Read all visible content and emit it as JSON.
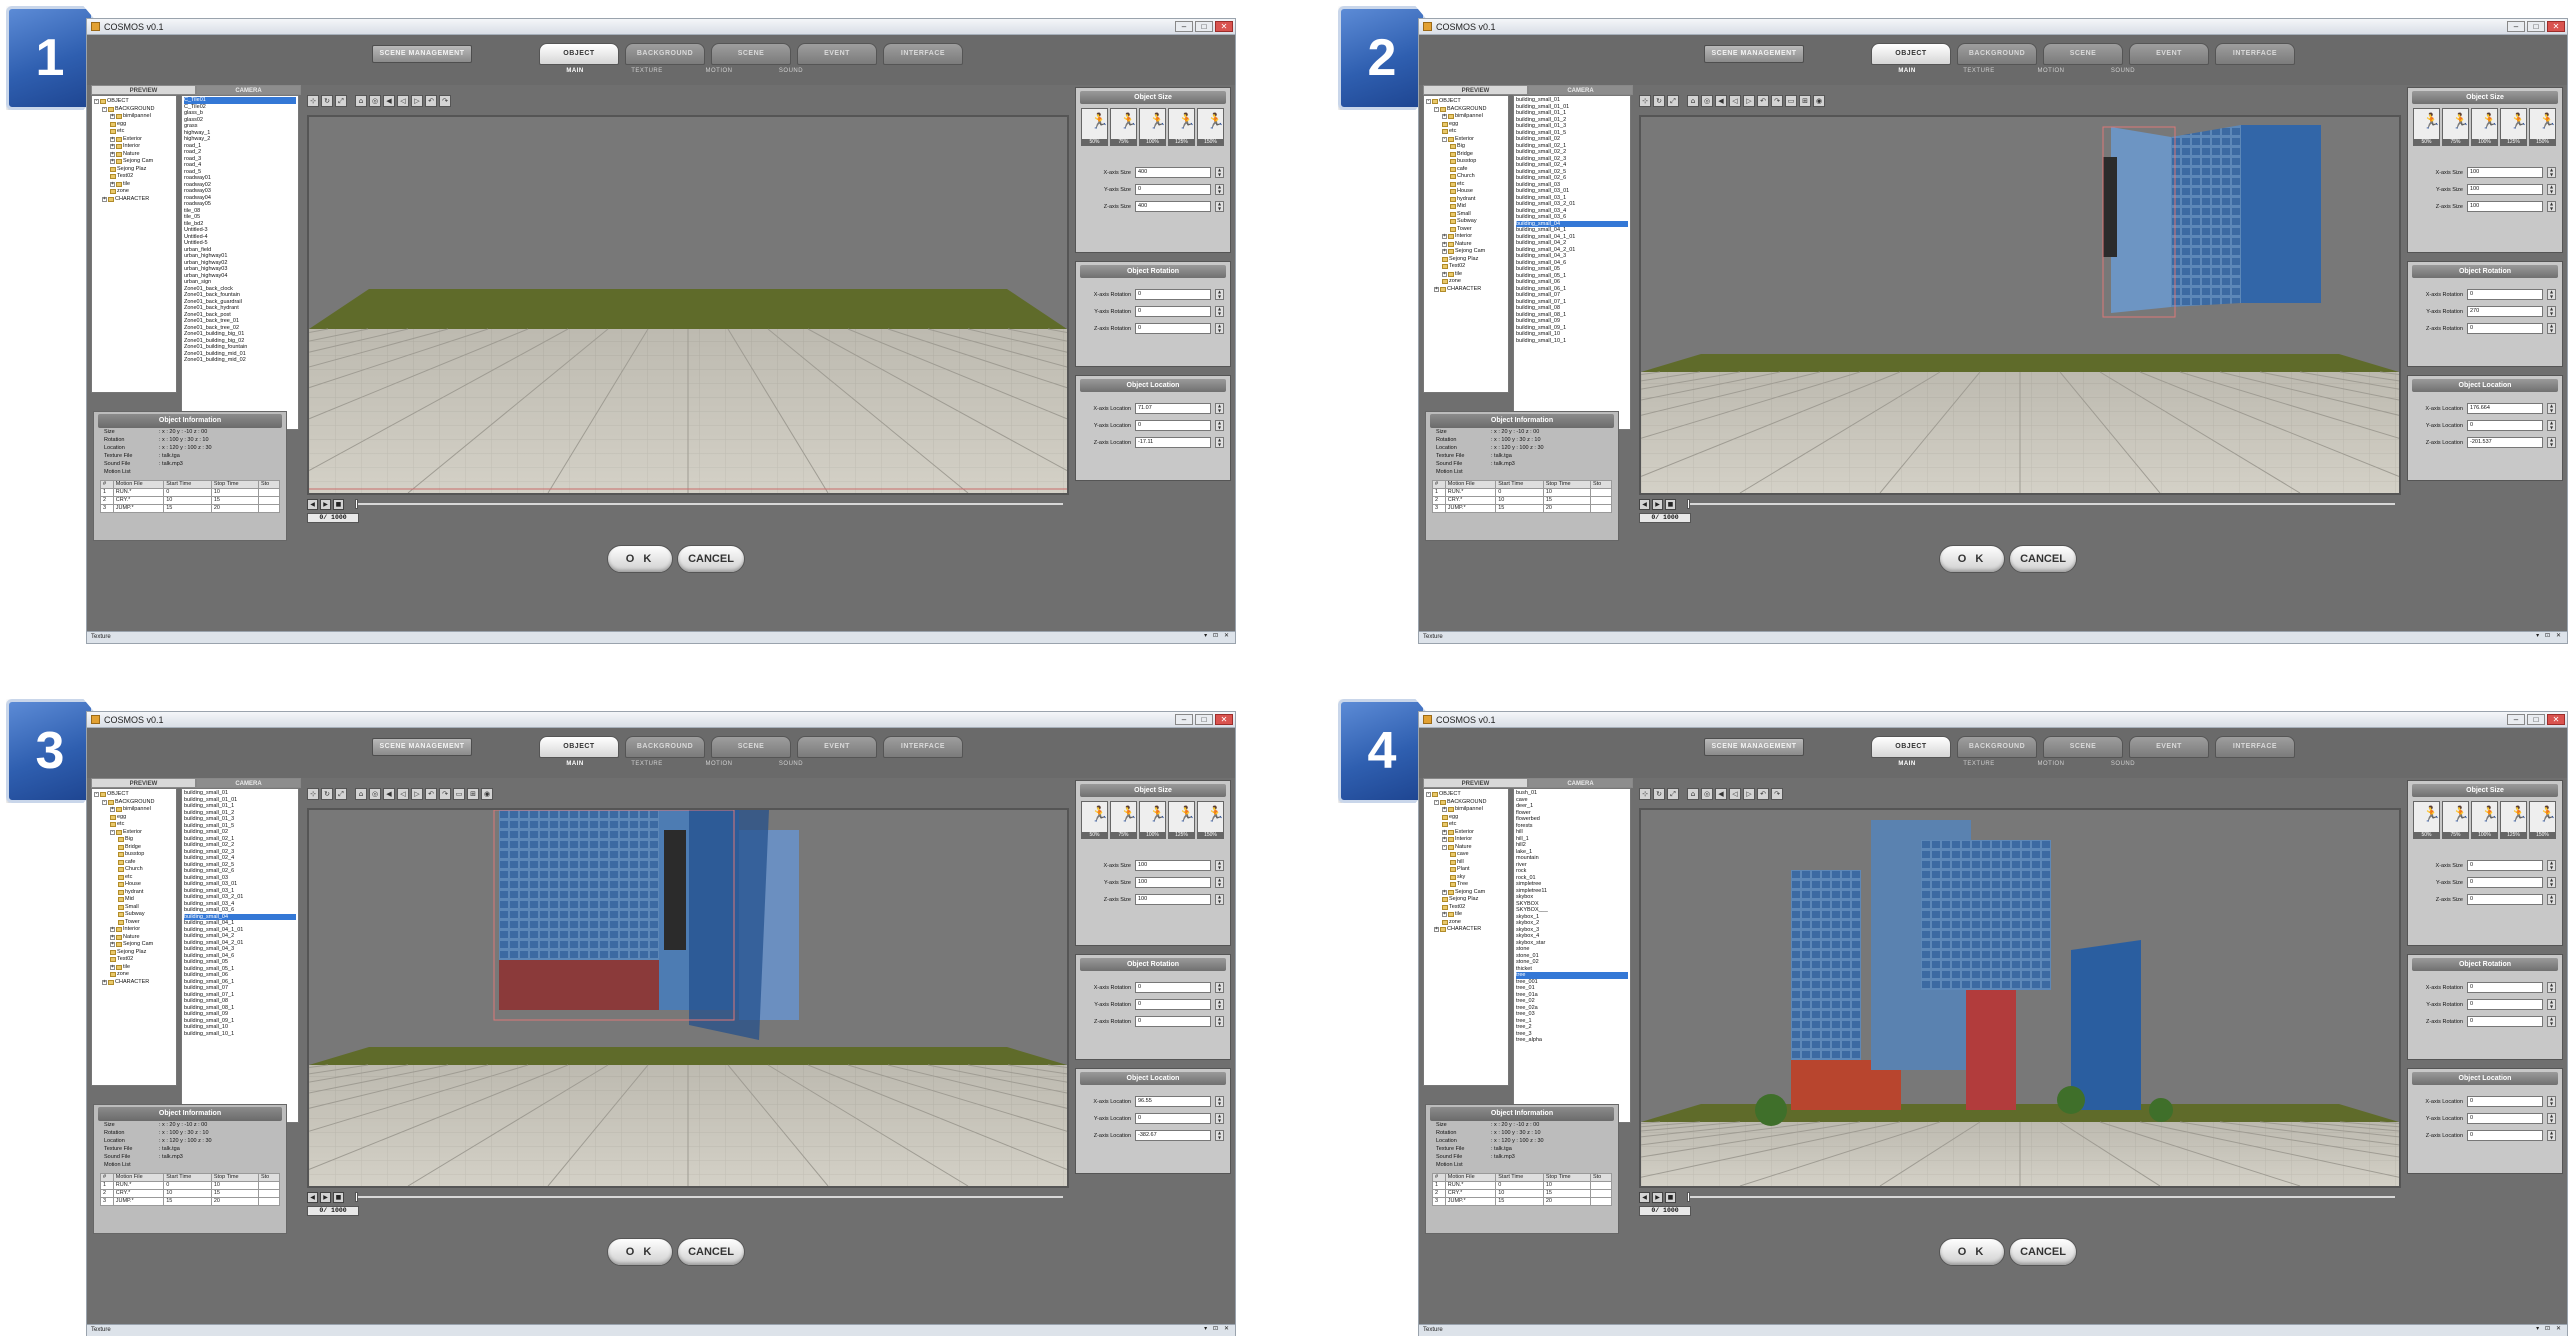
{
  "window": {
    "app_title": "COSMOS v0.1",
    "status_text": "Texture"
  },
  "toolbar_top": {
    "scene_management": "SCENE MANAGEMENT",
    "tabs": [
      "OBJECT",
      "BACKGROUND",
      "SCENE",
      "EVENT",
      "INTERFACE"
    ],
    "subtabs": [
      "MAIN",
      "TEXTURE",
      "MOTION",
      "SOUND"
    ]
  },
  "left_tabs": {
    "preview": "PREVIEW",
    "camera": "CAMERA"
  },
  "object_information": {
    "header": "Object Information",
    "rows": [
      {
        "k": "Size",
        "v": ":   x : 20   y : -10   z : 00"
      },
      {
        "k": "Rotation",
        "v": ":   x : 100   y : 30   z : 10"
      },
      {
        "k": "Location",
        "v": ":   x : 120   y : 100   z : 30"
      },
      {
        "k": "Texture File",
        "v": ":   talk.tga"
      },
      {
        "k": "Sound File",
        "v": ":   talk.mp3"
      },
      {
        "k": "Motion List",
        "v": ""
      }
    ],
    "motion_headers": [
      "#",
      "Motion File",
      "Start Time",
      "Stop Time",
      "Sto"
    ],
    "motion_rows": [
      [
        "1",
        "RUN.*",
        "0",
        "10",
        ""
      ],
      [
        "2",
        "CRY.*",
        "10",
        "15",
        ""
      ],
      [
        "3",
        "JUMP.*",
        "15",
        "20",
        ""
      ]
    ]
  },
  "right_panel": {
    "size_header": "Object Size",
    "size_buttons": [
      "50%",
      "75%",
      "100%",
      "125%",
      "150%"
    ],
    "size_labels": [
      "X-axis Size",
      "Y-axis Size",
      "Z-axis Size"
    ],
    "rotation_header": "Object Rotation",
    "rotation_labels": [
      "X-axis Rotation",
      "Y-axis Rotation",
      "Z-axis Rotation"
    ],
    "location_header": "Object Location",
    "location_labels": [
      "X-axis Location",
      "Y-axis Location",
      "Z-axis Location"
    ]
  },
  "buttons": {
    "ok": "O K",
    "cancel": "CANCEL"
  },
  "timeline": {
    "counter": "0/ 1000"
  },
  "panels": [
    {
      "number": "1",
      "tree": [
        {
          "label": "OBJECT",
          "depth": 0,
          "exp": "-"
        },
        {
          "label": "BACKGROUND",
          "depth": 1,
          "exp": "-"
        },
        {
          "label": "bimilpannel",
          "depth": 2,
          "exp": "+"
        },
        {
          "label": "egg",
          "depth": 2,
          "exp": ""
        },
        {
          "label": "etc",
          "depth": 2,
          "exp": ""
        },
        {
          "label": "Exterior",
          "depth": 2,
          "exp": "+"
        },
        {
          "label": "Interior",
          "depth": 2,
          "exp": "+"
        },
        {
          "label": "Nature",
          "depth": 2,
          "exp": "+"
        },
        {
          "label": "Sejong Cam",
          "depth": 2,
          "exp": "+"
        },
        {
          "label": "Sejong Plaz",
          "depth": 2,
          "exp": ""
        },
        {
          "label": "Test02",
          "depth": 2,
          "exp": ""
        },
        {
          "label": "tile",
          "depth": 2,
          "exp": "+"
        },
        {
          "label": "zone",
          "depth": 2,
          "exp": ""
        },
        {
          "label": "CHARACTER",
          "depth": 1,
          "exp": "+"
        }
      ],
      "list": [
        "C_Tile01",
        "C_Tile02",
        "glass_b",
        "glass02",
        "grass",
        "highway_1",
        "highway_2",
        "road_1",
        "road_2",
        "road_3",
        "road_4",
        "road_5",
        "roadway01",
        "roadway02",
        "roadway03",
        "roadway04",
        "roadway05",
        "tile_08",
        "tile_05",
        "tile_bd2",
        "Untitled-3",
        "Untitled-4",
        "Untitled-5",
        "urban_field",
        "urban_highway01",
        "urban_highway02",
        "urban_highway03",
        "urban_highway04",
        "urban_sign",
        "Zone01_back_clock",
        "Zone01_back_fountain",
        "Zone01_back_guardrail",
        "Zone01_back_hydrant",
        "Zone01_back_post",
        "Zone01_back_tree_01",
        "Zone01_back_tree_02",
        "Zone01_building_big_01",
        "Zone01_building_big_02",
        "Zone01_building_fountain",
        "Zone01_building_mid_01",
        "Zone01_building_mid_02"
      ],
      "selected": 0,
      "size": [
        "400",
        "0",
        "400"
      ],
      "rotation": [
        "0",
        "0",
        "0"
      ],
      "location": [
        "71.07",
        "0",
        "-17.11"
      ],
      "scene": "floor"
    },
    {
      "number": "2",
      "tree": [
        {
          "label": "OBJECT",
          "depth": 0,
          "exp": "-"
        },
        {
          "label": "BACKGROUND",
          "depth": 1,
          "exp": "-"
        },
        {
          "label": "bimilpannel",
          "depth": 2,
          "exp": "+"
        },
        {
          "label": "egg",
          "depth": 2,
          "exp": ""
        },
        {
          "label": "etc",
          "depth": 2,
          "exp": ""
        },
        {
          "label": "Exterior",
          "depth": 2,
          "exp": "-"
        },
        {
          "label": "Big",
          "depth": 3,
          "exp": ""
        },
        {
          "label": "Bridge",
          "depth": 3,
          "exp": ""
        },
        {
          "label": "busstop",
          "depth": 3,
          "exp": ""
        },
        {
          "label": "cafe",
          "depth": 3,
          "exp": ""
        },
        {
          "label": "Church",
          "depth": 3,
          "exp": ""
        },
        {
          "label": "etc",
          "depth": 3,
          "exp": ""
        },
        {
          "label": "House",
          "depth": 3,
          "exp": ""
        },
        {
          "label": "hydrant",
          "depth": 3,
          "exp": ""
        },
        {
          "label": "Mid",
          "depth": 3,
          "exp": ""
        },
        {
          "label": "Small",
          "depth": 3,
          "exp": ""
        },
        {
          "label": "Subway",
          "depth": 3,
          "exp": ""
        },
        {
          "label": "Tower",
          "depth": 3,
          "exp": ""
        },
        {
          "label": "Interior",
          "depth": 2,
          "exp": "+"
        },
        {
          "label": "Nature",
          "depth": 2,
          "exp": "+"
        },
        {
          "label": "Sejong Cam",
          "depth": 2,
          "exp": "+"
        },
        {
          "label": "Sejong Plaz",
          "depth": 2,
          "exp": ""
        },
        {
          "label": "Test02",
          "depth": 2,
          "exp": ""
        },
        {
          "label": "tile",
          "depth": 2,
          "exp": "+"
        },
        {
          "label": "zone",
          "depth": 2,
          "exp": ""
        },
        {
          "label": "CHARACTER",
          "depth": 1,
          "exp": "+"
        }
      ],
      "list": [
        "building_small_01",
        "building_small_01_01",
        "building_small_01_1",
        "building_small_01_2",
        "building_small_01_3",
        "building_small_01_5",
        "building_small_02",
        "building_small_02_1",
        "building_small_02_2",
        "building_small_02_3",
        "building_small_02_4",
        "building_small_02_5",
        "building_small_02_6",
        "building_small_03",
        "building_small_03_01",
        "building_small_03_1",
        "building_small_03_2_01",
        "building_small_03_4",
        "building_small_03_6",
        "building_small_04",
        "building_small_04_1",
        "building_small_04_1_01",
        "building_small_04_2",
        "building_small_04_2_01",
        "building_small_04_3",
        "building_small_04_6",
        "building_small_05",
        "building_small_05_1",
        "building_small_06",
        "building_small_06_1",
        "building_small_07",
        "building_small_07_1",
        "building_small_08",
        "building_small_08_1",
        "building_small_09",
        "building_small_09_1",
        "building_small_10",
        "building_small_10_1"
      ],
      "selected": 19,
      "size": [
        "100",
        "100",
        "100"
      ],
      "rotation": [
        "0",
        "270",
        "0"
      ],
      "location": [
        "176.664",
        "0",
        "-201.537"
      ],
      "scene": "building"
    },
    {
      "number": "3",
      "tree": [
        {
          "label": "OBJECT",
          "depth": 0,
          "exp": "-"
        },
        {
          "label": "BACKGROUND",
          "depth": 1,
          "exp": "-"
        },
        {
          "label": "bimilpannel",
          "depth": 2,
          "exp": "+"
        },
        {
          "label": "egg",
          "depth": 2,
          "exp": ""
        },
        {
          "label": "etc",
          "depth": 2,
          "exp": ""
        },
        {
          "label": "Exterior",
          "depth": 2,
          "exp": "-"
        },
        {
          "label": "Big",
          "depth": 3,
          "exp": ""
        },
        {
          "label": "Bridge",
          "depth": 3,
          "exp": ""
        },
        {
          "label": "busstop",
          "depth": 3,
          "exp": ""
        },
        {
          "label": "cafe",
          "depth": 3,
          "exp": ""
        },
        {
          "label": "Church",
          "depth": 3,
          "exp": ""
        },
        {
          "label": "etc",
          "depth": 3,
          "exp": ""
        },
        {
          "label": "House",
          "depth": 3,
          "exp": ""
        },
        {
          "label": "hydrant",
          "depth": 3,
          "exp": ""
        },
        {
          "label": "Mid",
          "depth": 3,
          "exp": ""
        },
        {
          "label": "Small",
          "depth": 3,
          "exp": ""
        },
        {
          "label": "Subway",
          "depth": 3,
          "exp": ""
        },
        {
          "label": "Tower",
          "depth": 3,
          "exp": ""
        },
        {
          "label": "Interior",
          "depth": 2,
          "exp": "+"
        },
        {
          "label": "Nature",
          "depth": 2,
          "exp": "+"
        },
        {
          "label": "Sejong Cam",
          "depth": 2,
          "exp": "+"
        },
        {
          "label": "Sejong Plaz",
          "depth": 2,
          "exp": ""
        },
        {
          "label": "Test02",
          "depth": 2,
          "exp": ""
        },
        {
          "label": "tile",
          "depth": 2,
          "exp": "+"
        },
        {
          "label": "zone",
          "depth": 2,
          "exp": ""
        },
        {
          "label": "CHARACTER",
          "depth": 1,
          "exp": "+"
        }
      ],
      "list": [
        "building_small_01",
        "building_small_01_01",
        "building_small_01_1",
        "building_small_01_2",
        "building_small_01_3",
        "building_small_01_5",
        "building_small_02",
        "building_small_02_1",
        "building_small_02_2",
        "building_small_02_3",
        "building_small_02_4",
        "building_small_02_5",
        "building_small_02_6",
        "building_small_03",
        "building_small_03_01",
        "building_small_03_1",
        "building_small_03_2_01",
        "building_small_03_4",
        "building_small_03_6",
        "building_small_04",
        "building_small_04_1",
        "building_small_04_1_01",
        "building_small_04_2",
        "building_small_04_2_01",
        "building_small_04_3",
        "building_small_04_6",
        "building_small_05",
        "building_small_05_1",
        "building_small_06",
        "building_small_06_1",
        "building_small_07",
        "building_small_07_1",
        "building_small_08",
        "building_small_08_1",
        "building_small_09",
        "building_small_09_1",
        "building_small_10",
        "building_small_10_1"
      ],
      "selected": 19,
      "size": [
        "100",
        "100",
        "100"
      ],
      "rotation": [
        "0",
        "0",
        "0"
      ],
      "location": [
        "96.55",
        "0",
        "-382.67"
      ],
      "scene": "buildings"
    },
    {
      "number": "4",
      "tree": [
        {
          "label": "OBJECT",
          "depth": 0,
          "exp": "-"
        },
        {
          "label": "BACKGROUND",
          "depth": 1,
          "exp": "-"
        },
        {
          "label": "bimilpannel",
          "depth": 2,
          "exp": "+"
        },
        {
          "label": "egg",
          "depth": 2,
          "exp": ""
        },
        {
          "label": "etc",
          "depth": 2,
          "exp": ""
        },
        {
          "label": "Exterior",
          "depth": 2,
          "exp": "+"
        },
        {
          "label": "Interior",
          "depth": 2,
          "exp": "+"
        },
        {
          "label": "Nature",
          "depth": 2,
          "exp": "-"
        },
        {
          "label": "cave",
          "depth": 3,
          "exp": ""
        },
        {
          "label": "hill",
          "depth": 3,
          "exp": ""
        },
        {
          "label": "Plant",
          "depth": 3,
          "exp": ""
        },
        {
          "label": "sky",
          "depth": 3,
          "exp": ""
        },
        {
          "label": "Tree",
          "depth": 3,
          "exp": ""
        },
        {
          "label": "Sejong Cam",
          "depth": 2,
          "exp": "+"
        },
        {
          "label": "Sejong Plaz",
          "depth": 2,
          "exp": ""
        },
        {
          "label": "Test02",
          "depth": 2,
          "exp": ""
        },
        {
          "label": "tile",
          "depth": 2,
          "exp": "+"
        },
        {
          "label": "zone",
          "depth": 2,
          "exp": ""
        },
        {
          "label": "CHARACTER",
          "depth": 1,
          "exp": "+"
        }
      ],
      "list": [
        "bush_01",
        "cave",
        "deer_1",
        "flower",
        "flowerbed",
        "forests",
        "hill",
        "hill_1",
        "hill2",
        "lake_1",
        "mountain",
        "river",
        "rock",
        "rock_01",
        "simpletree",
        "simpletree11",
        "skybox",
        "SKYBOX",
        "SKYBOX___",
        "skybox_1",
        "skybox_2",
        "skybox_3",
        "skybox_4",
        "skybox_star",
        "stone",
        "stone_01",
        "stone_02",
        "thicket",
        "tree",
        "tree_001",
        "tree_01",
        "tree_01a",
        "tree_02",
        "tree_02a",
        "tree_03",
        "tree_1",
        "tree_2",
        "tree_3",
        "tree_alpha"
      ],
      "selected": 28,
      "size": [
        "0",
        "0",
        "0"
      ],
      "rotation": [
        "0",
        "0",
        "0"
      ],
      "location": [
        "0",
        "0",
        "0"
      ],
      "scene": "city"
    }
  ]
}
